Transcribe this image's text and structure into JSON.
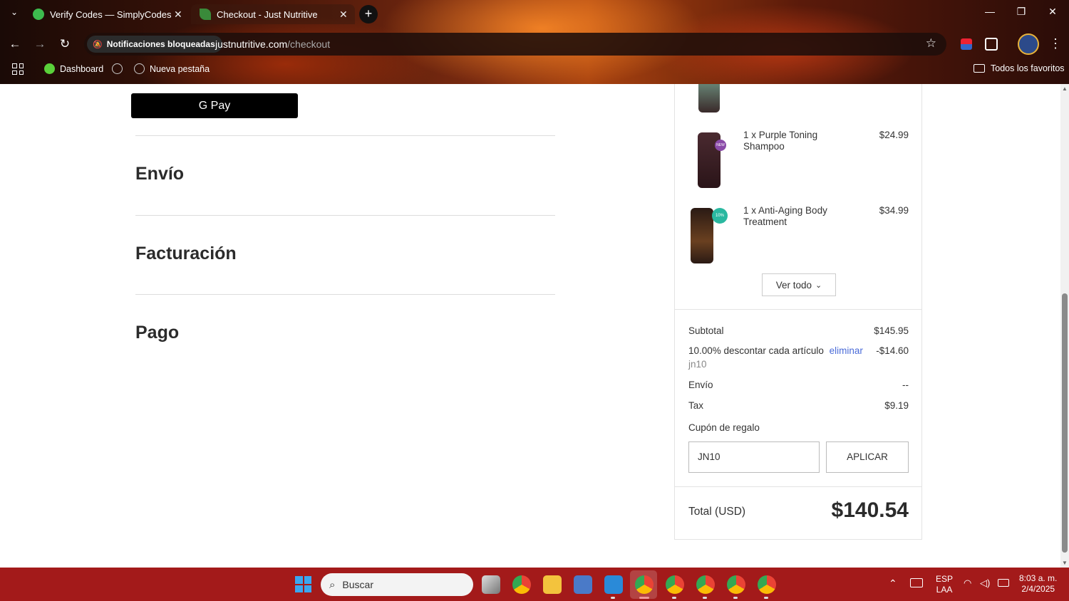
{
  "browser": {
    "tabs": [
      {
        "title": "Verify Codes — SimplyCodes",
        "close": "✕"
      },
      {
        "title": "Checkout - Just Nutritive",
        "close": "✕"
      }
    ],
    "new_tab": "+",
    "tab_list": "⌄",
    "window": {
      "minimize": "—",
      "maximize": "❐",
      "close": "✕"
    },
    "nav": {
      "back": "←",
      "forward": "→",
      "reload": "↻"
    },
    "notif_chip": "Notificaciones bloqueadas",
    "url_host": "justnutritive.com",
    "url_path": "/checkout",
    "star": "☆",
    "bookmarks": [
      {
        "label": "Dashboard"
      },
      {
        "label": "Nueva pestaña"
      }
    ],
    "all_bookmarks": "Todos los favoritos"
  },
  "checkout": {
    "gpay_label": "G Pay",
    "sections": [
      "Envío",
      "Facturación",
      "Pago"
    ]
  },
  "summary": {
    "items": [
      {
        "name": "1 x Purple Toning Shampoo",
        "price": "$24.99",
        "badge": "NEW"
      },
      {
        "name": "1 x Anti-Aging Body Treatment",
        "price": "$34.99",
        "badge": "10% OFF"
      }
    ],
    "ver_todo": "Ver todo",
    "ver_todo_icon": "⌄",
    "subtotal_label": "Subtotal",
    "subtotal_value": "$145.95",
    "discount_label": "10.00% descontar cada artículo",
    "discount_remove": "eliminar",
    "discount_value": "-$14.60",
    "discount_code": "jn10",
    "shipping_label": "Envío",
    "shipping_value": "--",
    "tax_label": "Tax",
    "tax_value": "$9.19",
    "gift_label": "Cupón de regalo",
    "coupon_value": "JN10",
    "apply_label": "APLICAR",
    "total_label": "Total (USD)",
    "total_value": "$140.54"
  },
  "taskbar": {
    "search_placeholder": "Buscar",
    "lang_top": "ESP",
    "lang_bottom": "LAA",
    "time": "8:03 a. m.",
    "date": "2/4/2025"
  },
  "colors": {
    "link": "#4a6bd8",
    "taskbar": "#a31a1a"
  }
}
